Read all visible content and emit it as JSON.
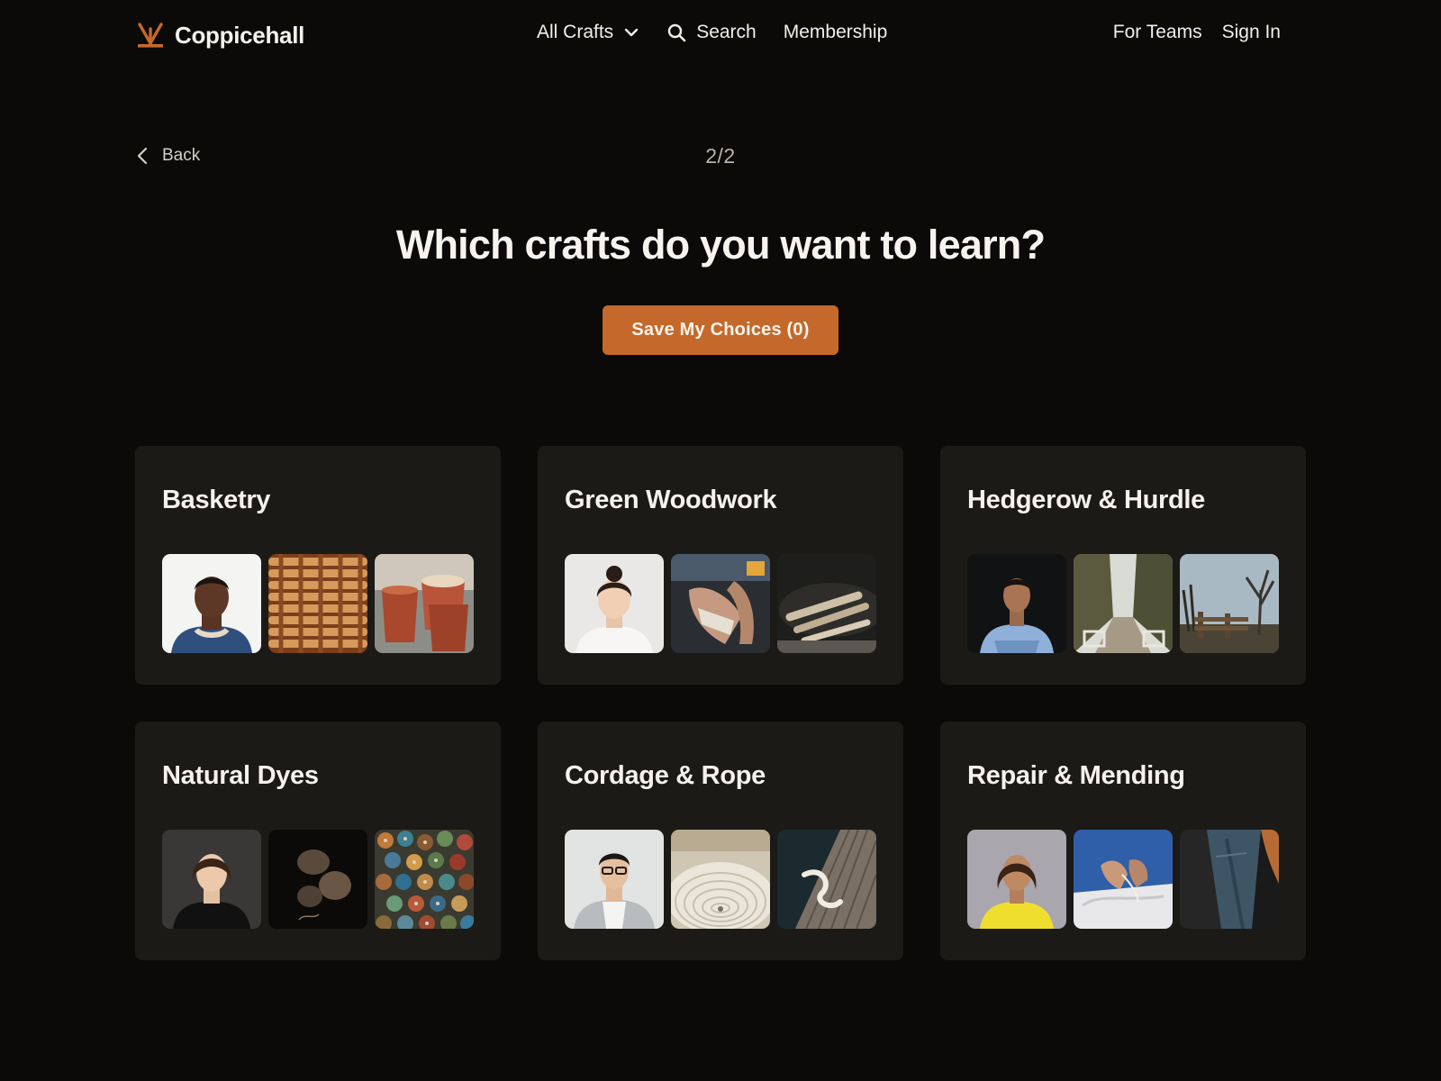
{
  "brand": {
    "name": "Coppicehall",
    "accent_color": "#c4692b",
    "logo_icon": "sprout-icon"
  },
  "nav": {
    "crafts_label": "All Crafts",
    "search_label": "Search",
    "membership_label": "Membership",
    "teams_label": "For Teams",
    "signin_label": "Sign In"
  },
  "step": {
    "back_label": "Back",
    "counter": "2/2"
  },
  "main": {
    "title": "Which crafts do you want to learn?",
    "cta_label": "Save My Choices (0)"
  },
  "crafts": [
    {
      "title": "Basketry",
      "thumbnails": [
        "instructor-portrait",
        "woven-willow-closeup",
        "finished-baskets"
      ]
    },
    {
      "title": "Green Woodwork",
      "thumbnails": [
        "instructor-portrait",
        "hands-carving-spoon",
        "carved-spoons"
      ]
    },
    {
      "title": "Hedgerow & Hurdle",
      "thumbnails": [
        "instructor-portrait",
        "country-lane-gate",
        "wooden-fence-trees"
      ]
    },
    {
      "title": "Natural Dyes",
      "thumbnails": [
        "instructor-portrait",
        "dried-dye-pods",
        "dyed-thread-spools"
      ]
    },
    {
      "title": "Cordage & Rope",
      "thumbnails": [
        "instructor-portrait",
        "coiled-rope",
        "rope-knot-on-deck"
      ]
    },
    {
      "title": "Repair & Mending",
      "thumbnails": [
        "instructor-portrait",
        "hands-sewing-fabric",
        "denim-jacket"
      ]
    }
  ]
}
